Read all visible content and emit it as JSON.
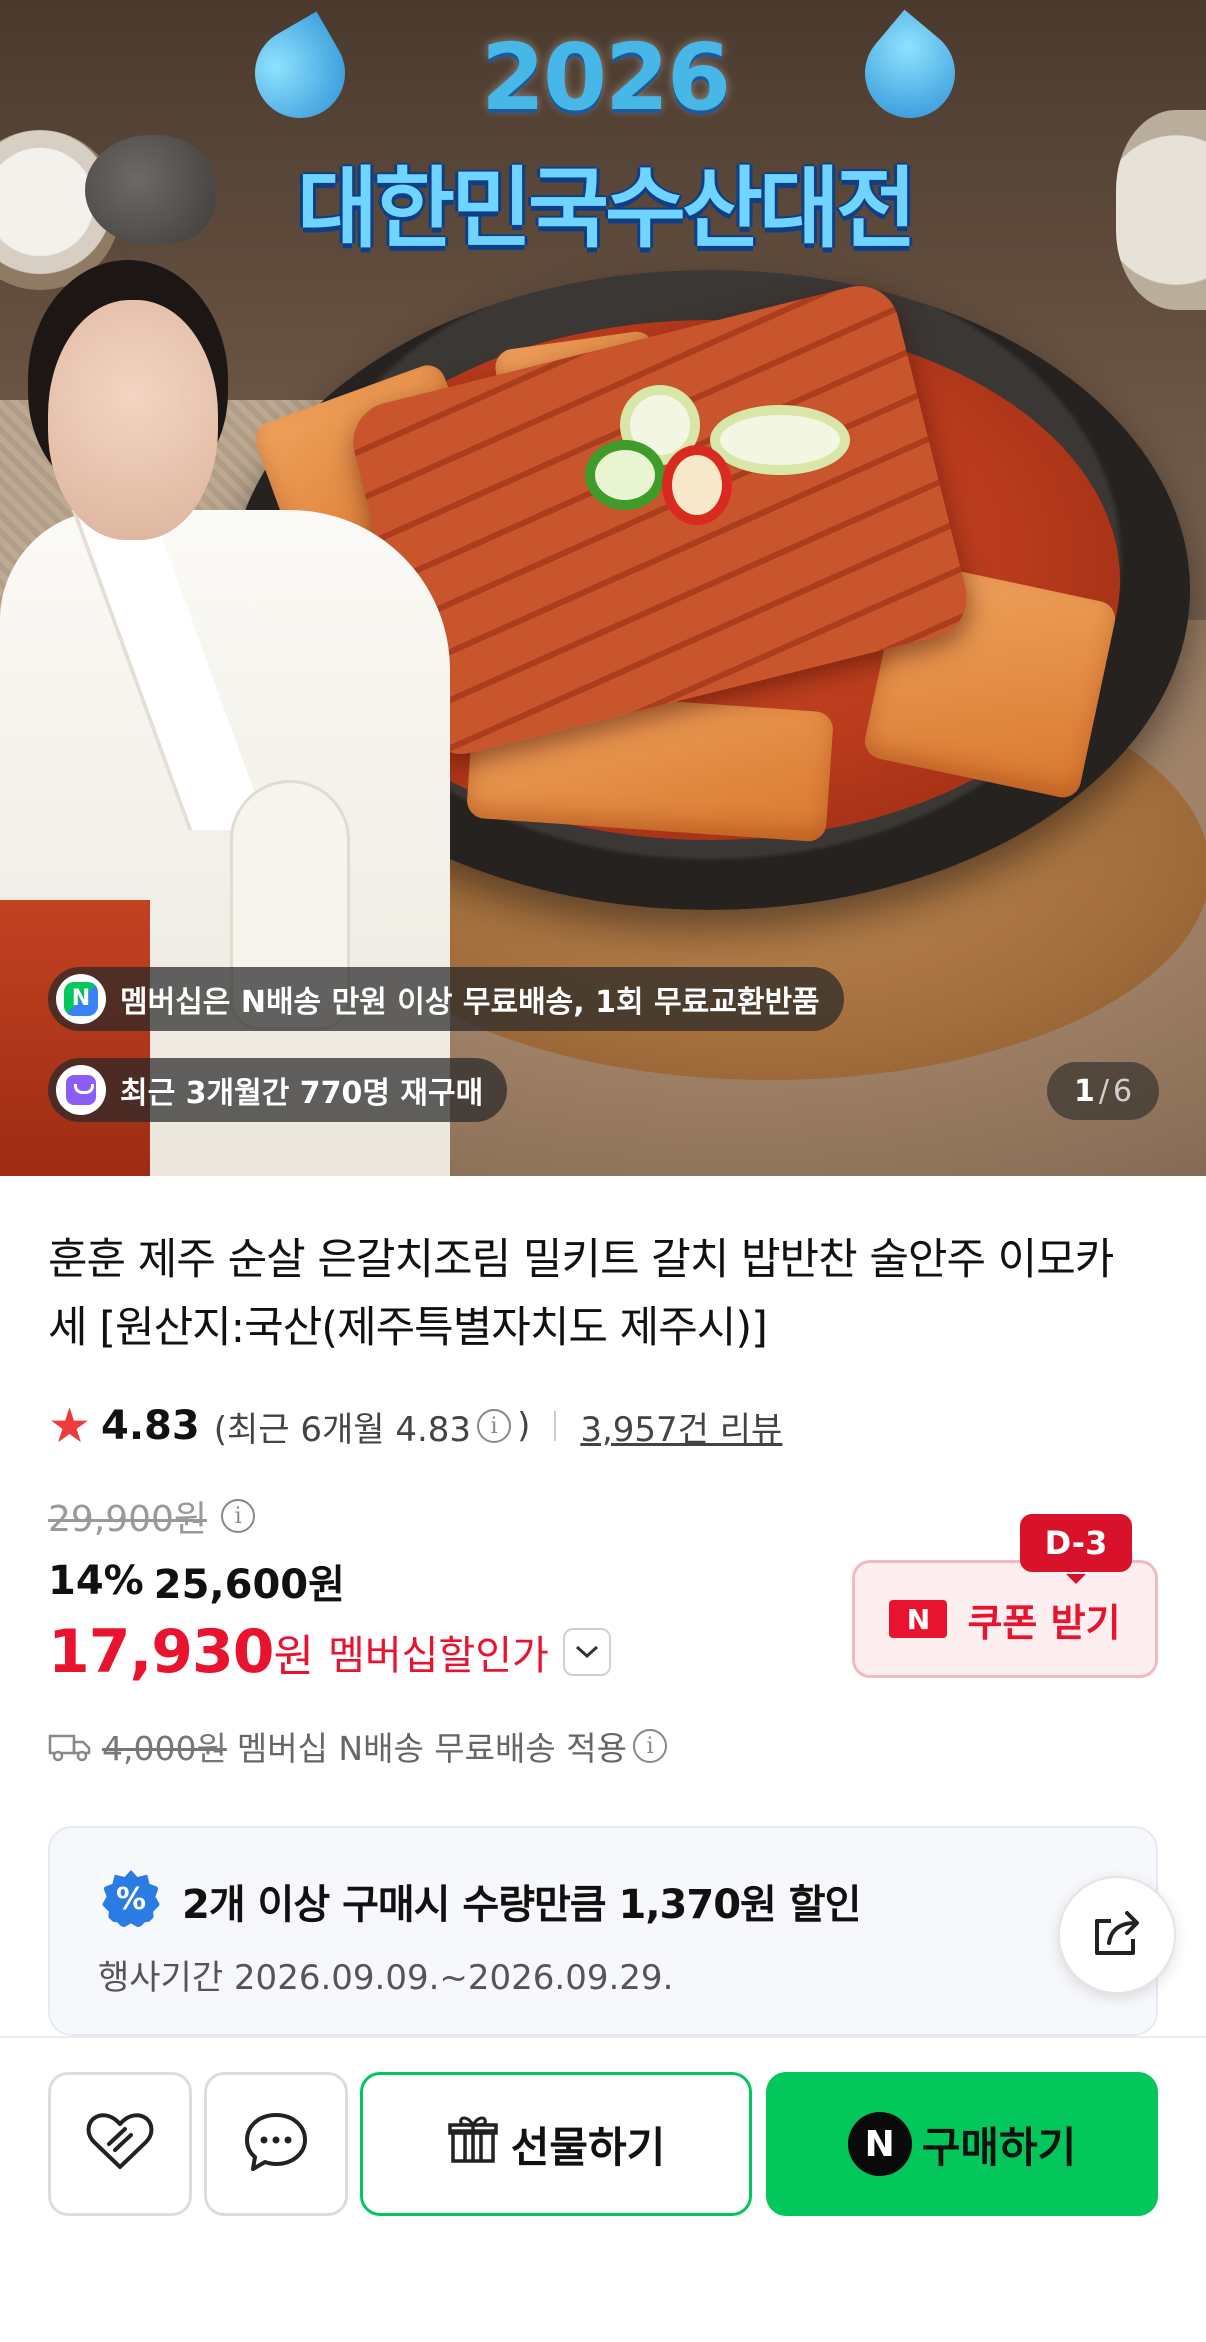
{
  "hero": {
    "event_year": "2026",
    "event_title": "대한민국수산대전",
    "badges": [
      {
        "icon": "naver-membership-icon",
        "text": "멤버십은 N배송 만원 이상 무료배송, 1회 무료교환반품"
      },
      {
        "icon": "shopping-bag-icon",
        "text": "최근 3개월간 770명 재구매"
      }
    ],
    "page_indicator": {
      "current": "1",
      "separator": "/",
      "total": "6"
    }
  },
  "product": {
    "title": "훈훈 제주 순살 은갈치조림 밀키트 갈치 밥반찬 술안주 이모카세 [원산지:국산(제주특별자치도 제주시)]",
    "rating": {
      "star_icon": "star-icon",
      "score": "4.83",
      "recent_prefix": "(최근 6개월 4.83",
      "recent_suffix": ")",
      "reviews": "3,957건 리뷰"
    },
    "price": {
      "original": "29,900원",
      "discount_percent": "14%",
      "discount_price": "25,600원",
      "member_price": "17,930",
      "member_currency": "원",
      "member_label": "멤버십할인가"
    },
    "shipping": {
      "fee": "4,000원",
      "text": "멤버십 N배송 무료배송 적용"
    },
    "coupon": {
      "dday": "D-3",
      "logo": "N",
      "label": "쿠폰 받기"
    },
    "promo": {
      "icon": "percent-icon",
      "title": "2개 이상 구매시 수량만큼 1,370원 할인",
      "period": "행사기간 2026.09.09.~2026.09.29."
    }
  },
  "actions": {
    "gift_label": "선물하기",
    "buy_logo": "N",
    "buy_label": "구매하기"
  },
  "colors": {
    "brand_green": "#03c75a",
    "sale_red": "#e8132f",
    "rating_star": "#ef3b3b"
  }
}
